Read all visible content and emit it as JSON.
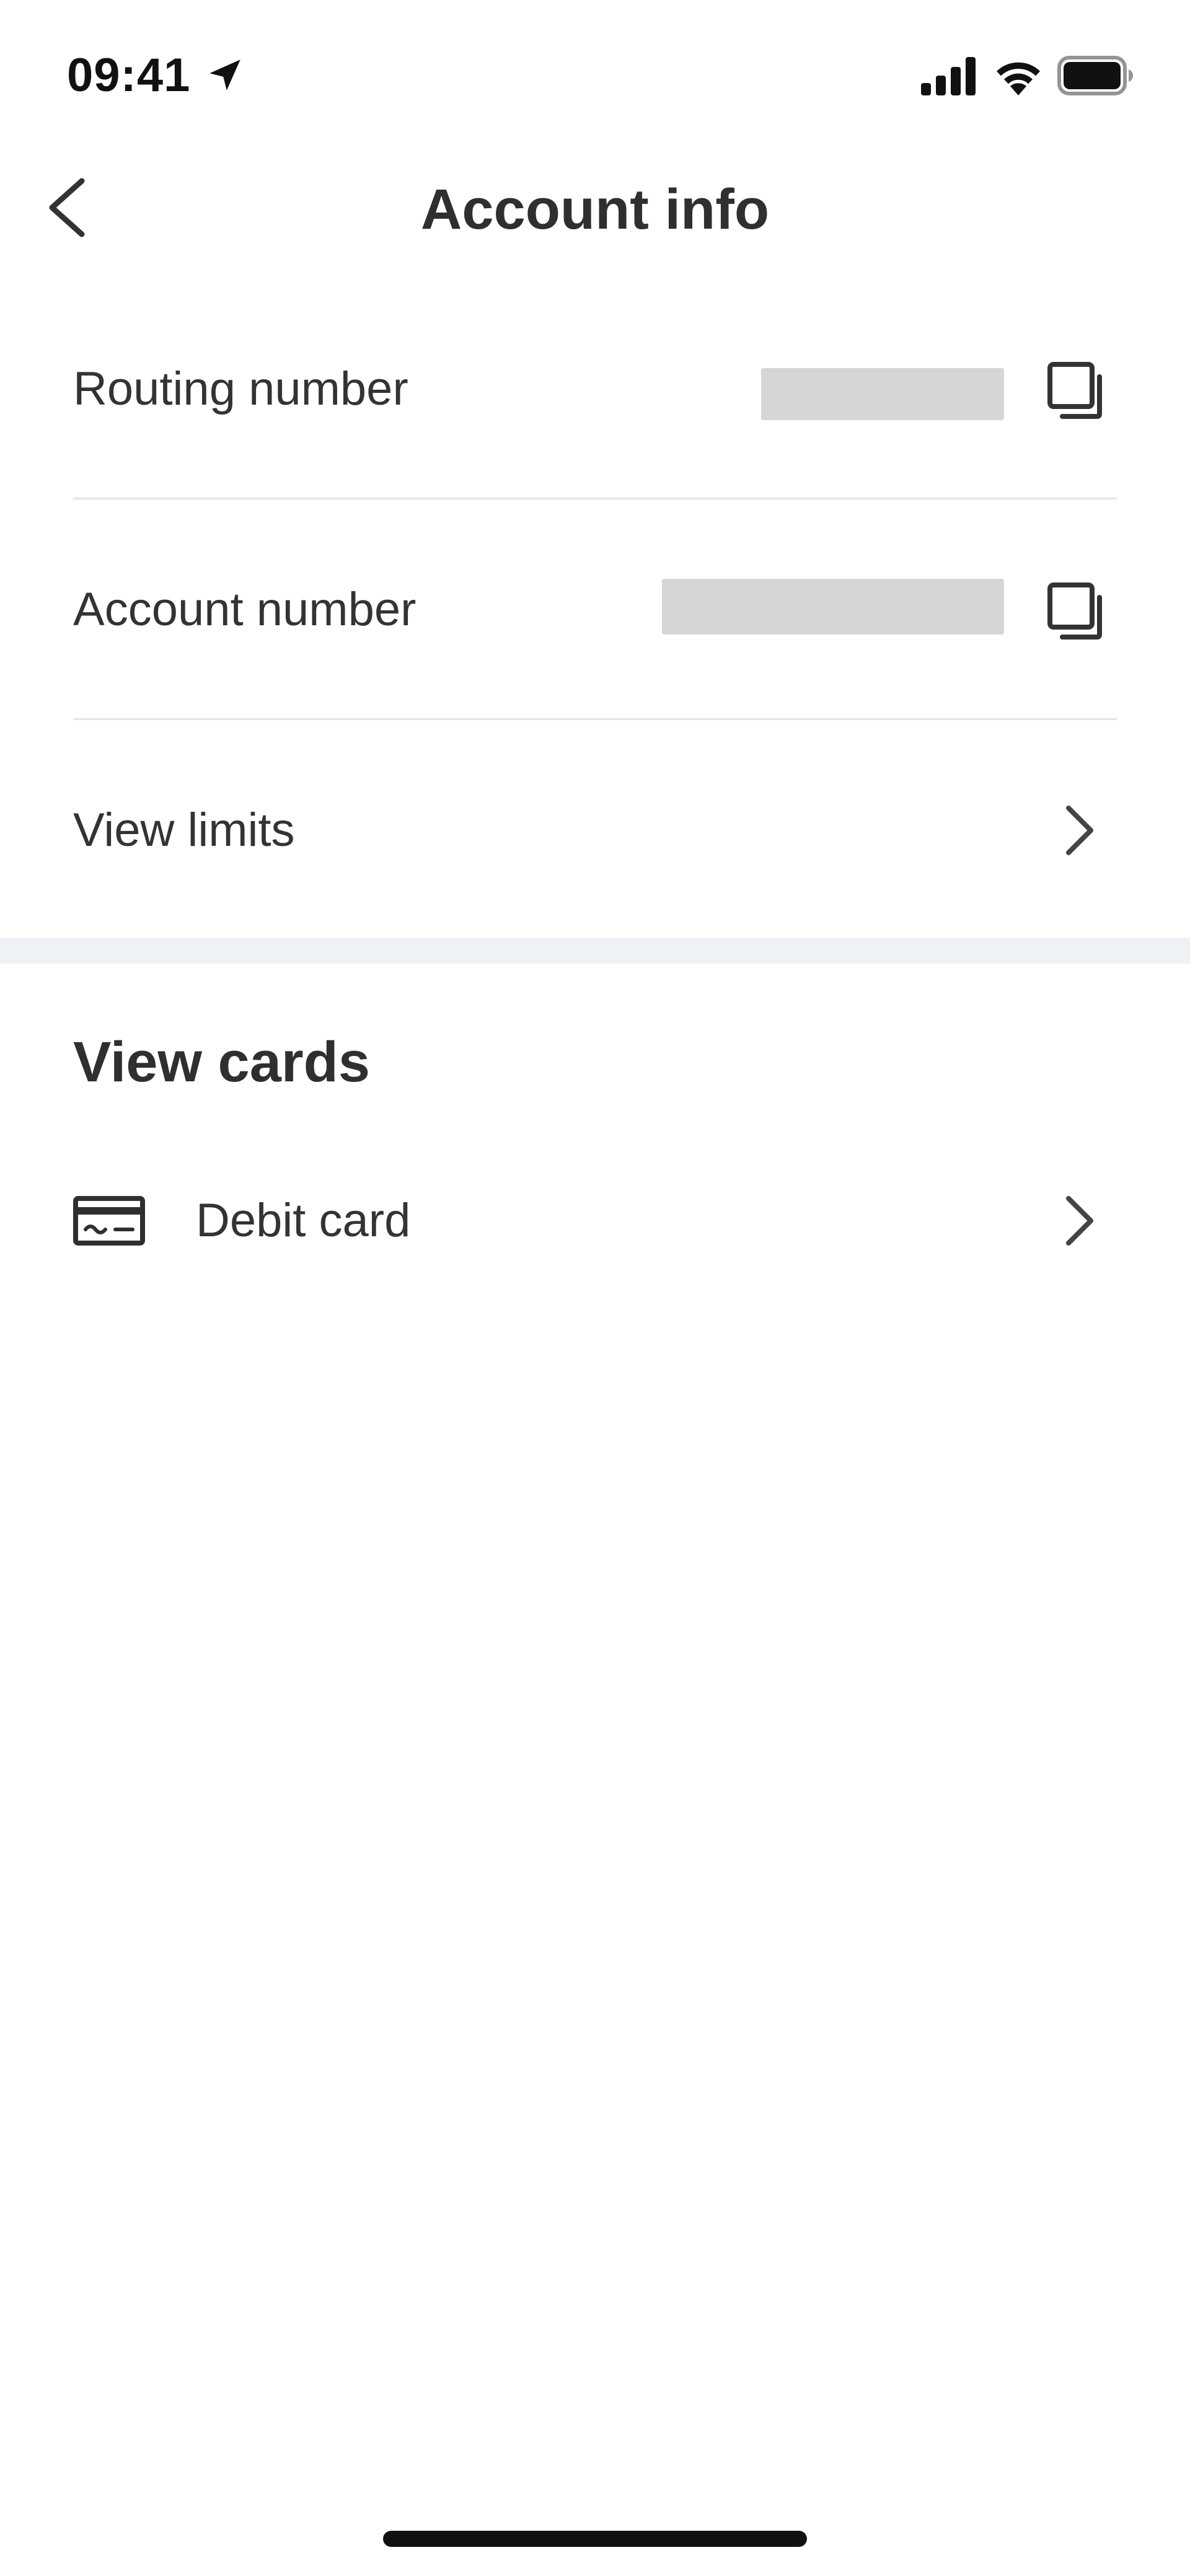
{
  "status_bar": {
    "time": "09:41",
    "icons": [
      "location-arrow-icon",
      "signal-icon",
      "wifi-icon",
      "battery-icon"
    ]
  },
  "header": {
    "title": "Account info",
    "back_icon": "chevron-left-icon"
  },
  "account_rows": [
    {
      "label": "Routing number",
      "value_redacted": true,
      "action_icon": "copy-icon"
    },
    {
      "label": "Account number",
      "value_redacted": true,
      "action_icon": "copy-icon"
    },
    {
      "label": "View limits",
      "action_icon": "chevron-right-icon"
    }
  ],
  "cards_section": {
    "title": "View cards",
    "items": [
      {
        "label": "Debit card",
        "icon": "credit-card-icon",
        "action_icon": "chevron-right-icon"
      }
    ]
  },
  "colors": {
    "text": "#2f2f2f",
    "divider": "#e3e5e8",
    "section_band": "#eff2f5",
    "redaction": "#d6d6d6"
  }
}
